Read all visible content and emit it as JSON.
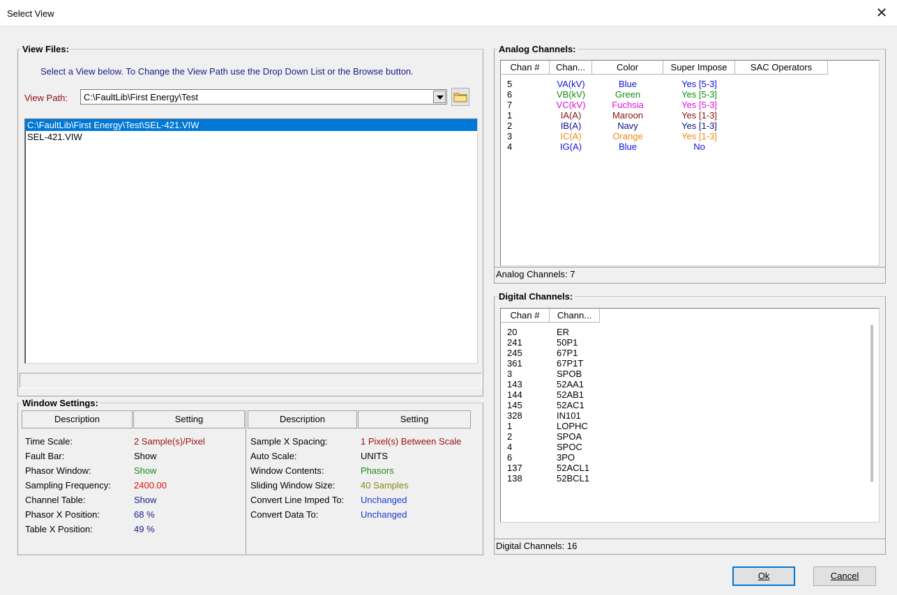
{
  "window": {
    "title": "Select View",
    "close_glyph": "✕"
  },
  "view_files": {
    "legend": "View Files:",
    "hint": "Select a View below. To Change the View Path use the Drop Down List or the Browse button.",
    "path_label": "View Path:",
    "path_value": "C:\\FaultLib\\First Energy\\Test",
    "files": [
      {
        "name": "C:\\FaultLib\\First Energy\\Test\\SEL-421.VIW",
        "selected": true
      },
      {
        "name": "SEL-421.VIW",
        "selected": false
      }
    ]
  },
  "window_settings": {
    "legend": "Window Settings:",
    "headers": [
      "Description",
      "Setting",
      "Description",
      "Setting"
    ],
    "left": [
      {
        "desc": "Time Scale:",
        "value": "2 Sample(s)/Pixel",
        "color": "#9b1010"
      },
      {
        "desc": "Fault Bar:",
        "value": "Show",
        "color": "#000000"
      },
      {
        "desc": "Phasor Window:",
        "value": "Show",
        "color": "#1a8a1a"
      },
      {
        "desc": "Sampling Frequency:",
        "value": "2400.00",
        "color": "#e01010"
      },
      {
        "desc": "Channel Table:",
        "value": "Show",
        "color": "#1a1a8c"
      },
      {
        "desc": "Phasor X Position:",
        "value": "68 %",
        "color": "#1a1a8c"
      },
      {
        "desc": "Table X Position:",
        "value": "49 %",
        "color": "#1a1a8c"
      }
    ],
    "right": [
      {
        "desc": "Sample X Spacing:",
        "value": "1 Pixel(s) Between Scale",
        "color": "#9b1010"
      },
      {
        "desc": "Auto Scale:",
        "value": "UNITS",
        "color": "#000000"
      },
      {
        "desc": "Window Contents:",
        "value": "Phasors",
        "color": "#1a8a1a"
      },
      {
        "desc": "Sliding Window Size:",
        "value": "40 Samples",
        "color": "#8a8a10"
      },
      {
        "desc": "Convert Line Imped To:",
        "value": "Unchanged",
        "color": "#1a3ad0"
      },
      {
        "desc": "Convert Data To:",
        "value": "Unchanged",
        "color": "#1a3ad0"
      }
    ]
  },
  "analog": {
    "legend": "Analog Channels:",
    "columns": [
      "Chan #",
      "Chan...",
      "Color",
      "Super Impose",
      "SAC Operators"
    ],
    "rows": [
      {
        "chan": "5",
        "name": "VA(kV)",
        "color": "Blue",
        "impose": "Yes [5-3]",
        "hex": "#1010e0"
      },
      {
        "chan": "6",
        "name": "VB(kV)",
        "color": "Green",
        "impose": "Yes [5-3]",
        "hex": "#108a10"
      },
      {
        "chan": "7",
        "name": "VC(kV)",
        "color": "Fuchsia",
        "impose": "Yes [5-3]",
        "hex": "#e010e0"
      },
      {
        "chan": "1",
        "name": "IA(A)",
        "color": "Maroon",
        "impose": "Yes [1-3]",
        "hex": "#8a1010"
      },
      {
        "chan": "2",
        "name": "IB(A)",
        "color": "Navy",
        "impose": "Yes [1-3]",
        "hex": "#10108a"
      },
      {
        "chan": "3",
        "name": "IC(A)",
        "color": "Orange",
        "impose": "Yes [1-3]",
        "hex": "#f08a10"
      },
      {
        "chan": "4",
        "name": "IG(A)",
        "color": "Blue",
        "impose": "No",
        "hex": "#1010e0"
      }
    ],
    "status": "Analog Channels: 7"
  },
  "digital": {
    "legend": "Digital Channels:",
    "columns": [
      "Chan #",
      "Chann..."
    ],
    "rows": [
      {
        "chan": "20",
        "name": "ER"
      },
      {
        "chan": "241",
        "name": "50P1"
      },
      {
        "chan": "245",
        "name": "67P1"
      },
      {
        "chan": "361",
        "name": "67P1T"
      },
      {
        "chan": "3",
        "name": "SPOB"
      },
      {
        "chan": "143",
        "name": "52AA1"
      },
      {
        "chan": "144",
        "name": "52AB1"
      },
      {
        "chan": "145",
        "name": "52AC1"
      },
      {
        "chan": "328",
        "name": "IN101"
      },
      {
        "chan": "1",
        "name": "LOPHC"
      },
      {
        "chan": "2",
        "name": "SPOA"
      },
      {
        "chan": "4",
        "name": "SPOC"
      },
      {
        "chan": "6",
        "name": "3PO"
      },
      {
        "chan": "137",
        "name": "52ACL1"
      },
      {
        "chan": "138",
        "name": "52BCL1"
      }
    ],
    "status": "Digital Channels: 16"
  },
  "buttons": {
    "ok_label": "Ok",
    "cancel_label": "Cancel"
  }
}
